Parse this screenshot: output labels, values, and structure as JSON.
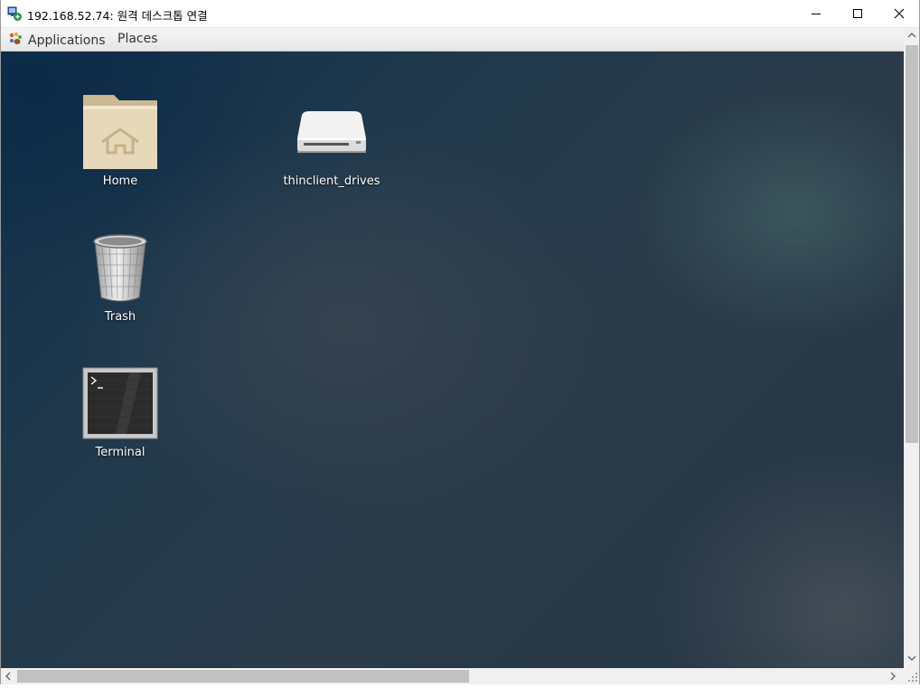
{
  "window": {
    "title": "192.168.52.74: 원격 데스크톱 연결",
    "icon": "remote-desktop-icon",
    "controls": [
      "minimize",
      "maximize",
      "close"
    ]
  },
  "panel": {
    "applications_label": "Applications",
    "places_label": "Places",
    "applications_icon": "gnome-foot-icon"
  },
  "desktop": {
    "icons": [
      {
        "label": "Home",
        "icon": "home-folder-icon"
      },
      {
        "label": "thinclient_drives",
        "icon": "drive-icon"
      },
      {
        "label": "Trash",
        "icon": "trash-icon"
      },
      {
        "label": "Terminal",
        "icon": "terminal-icon"
      }
    ]
  },
  "colors": {
    "desktop_base": "#223a4c",
    "panel_bg": "#ededed",
    "scrollbar_thumb": "#c1c1c1"
  }
}
